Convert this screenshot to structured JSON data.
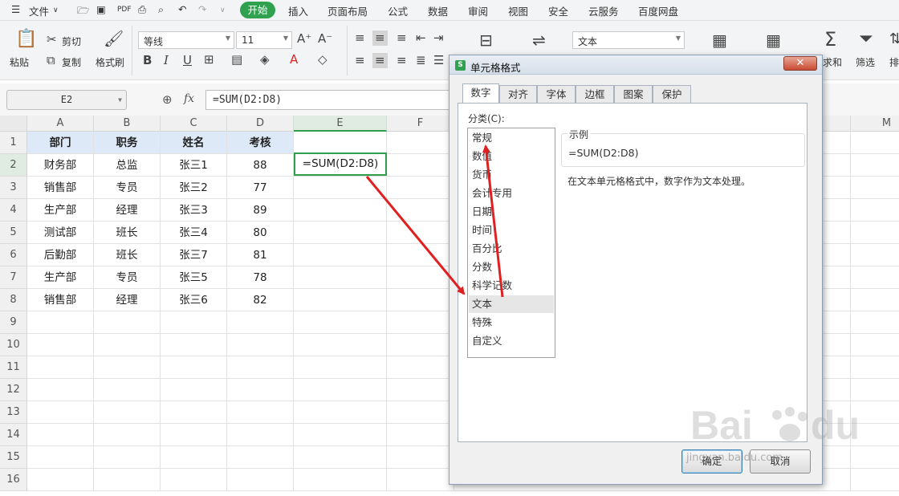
{
  "menubar": {
    "file": "文件",
    "tabs": [
      "开始",
      "插入",
      "页面布局",
      "公式",
      "数据",
      "审阅",
      "视图",
      "安全",
      "云服务",
      "百度网盘"
    ]
  },
  "ribbon": {
    "paste": "粘贴",
    "cut": "剪切",
    "copy": "复制",
    "format_painter": "格式刷",
    "font_name": "等线",
    "font_size": "11",
    "number_format": "文本",
    "sum": "求和",
    "filter": "筛选",
    "sort": "排"
  },
  "formula_bar": {
    "name_box": "E2",
    "fx": "fx",
    "formula": "=SUM(D2:D8)"
  },
  "sheet": {
    "columns": [
      "A",
      "B",
      "C",
      "D",
      "E",
      "F",
      "M"
    ],
    "rows": [
      "1",
      "2",
      "3",
      "4",
      "5",
      "6",
      "7",
      "8",
      "9",
      "10",
      "11",
      "12",
      "13",
      "14",
      "15",
      "16"
    ],
    "header": [
      "部门",
      "职务",
      "姓名",
      "考核"
    ],
    "data": [
      [
        "财务部",
        "总监",
        "张三1",
        "88"
      ],
      [
        "销售部",
        "专员",
        "张三2",
        "77"
      ],
      [
        "生产部",
        "经理",
        "张三3",
        "89"
      ],
      [
        "测试部",
        "班长",
        "张三4",
        "80"
      ],
      [
        "后勤部",
        "班长",
        "张三7",
        "81"
      ],
      [
        "生产部",
        "专员",
        "张三5",
        "78"
      ],
      [
        "销售部",
        "经理",
        "张三6",
        "82"
      ]
    ],
    "e2_value": "=SUM(D2:D8)"
  },
  "dialog": {
    "title": "单元格格式",
    "tabs": [
      "数字",
      "对齐",
      "字体",
      "边框",
      "图案",
      "保护"
    ],
    "category_label": "分类(C):",
    "categories": [
      "常规",
      "数值",
      "货币",
      "会计专用",
      "日期",
      "时间",
      "百分比",
      "分数",
      "科学记数",
      "文本",
      "特殊",
      "自定义"
    ],
    "selected_category": "文本",
    "sample_label": "示例",
    "sample_value": "=SUM(D2:D8)",
    "description": "在文本单元格格式中，数字作为文本处理。",
    "ok": "确定",
    "cancel": "取消"
  },
  "watermark": {
    "brand": "Baidu 经验",
    "url": "jingyan.baidu.com"
  },
  "colors": {
    "accent_green": "#2fa14f",
    "header_fill": "#dde9f6",
    "arrow_red": "#e02020"
  }
}
